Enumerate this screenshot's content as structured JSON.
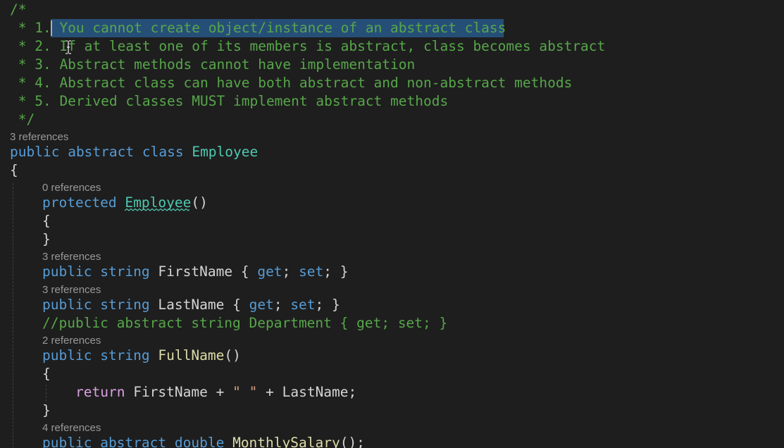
{
  "colors": {
    "background": "#1e1e1e",
    "comment": "#57a64a",
    "keyword": "#569cd6",
    "control_keyword": "#d8a0df",
    "type": "#4ec9b0",
    "method": "#dcdcaa",
    "string": "#d69d85",
    "plain": "#d4d4d4",
    "codelens": "#999999",
    "selection": "#264f78",
    "squiggle": "#4ec9b0"
  },
  "code": {
    "comment_open": "/*",
    "note1_prefix": " * 1.",
    "note1_text": " You cannot create object/instance of an abstract class",
    "note2": " * 2. If at least one of its members is abstract, class becomes abstract",
    "note3": " * 3. Abstract methods cannot have implementation",
    "note4": " * 4. Abstract class can have both abstract and non-abstract methods",
    "note5": " * 5. Derived classes MUST implement abstract methods",
    "comment_close": " */",
    "class_refs": "3 references",
    "class_kw_public": "public",
    "class_kw_abstract": "abstract",
    "class_kw_class": "class",
    "class_name": "Employee",
    "open_brace": "{",
    "close_brace": "}",
    "ctor_refs": "0 references",
    "ctor_kw": "protected",
    "ctor_name": "Employee",
    "ctor_parens": "()",
    "first_refs": "3 references",
    "first_kw_public": "public",
    "first_kw_string": "string",
    "first_name": "FirstName",
    "accessor_open": "{",
    "kw_get": "get",
    "semi": ";",
    "kw_set": "set",
    "accessor_close": "}",
    "last_refs": "3 references",
    "last_kw_public": "public",
    "last_kw_string": "string",
    "last_name": "LastName",
    "dept_comment": "//public abstract string Department { get; set; }",
    "full_refs": "2 references",
    "full_kw_public": "public",
    "full_kw_string": "string",
    "full_name": "FullName",
    "full_parens": "()",
    "return_kw": "return",
    "return_first": "FirstName",
    "plus": "+",
    "space_string": "\" \"",
    "return_last": "LastName",
    "monthly_refs": "4 references",
    "monthly_kw_public": "public",
    "monthly_kw_abstract": "abstract",
    "monthly_kw_double": "double",
    "monthly_name": "MonthlySalary",
    "monthly_tail": "();"
  }
}
